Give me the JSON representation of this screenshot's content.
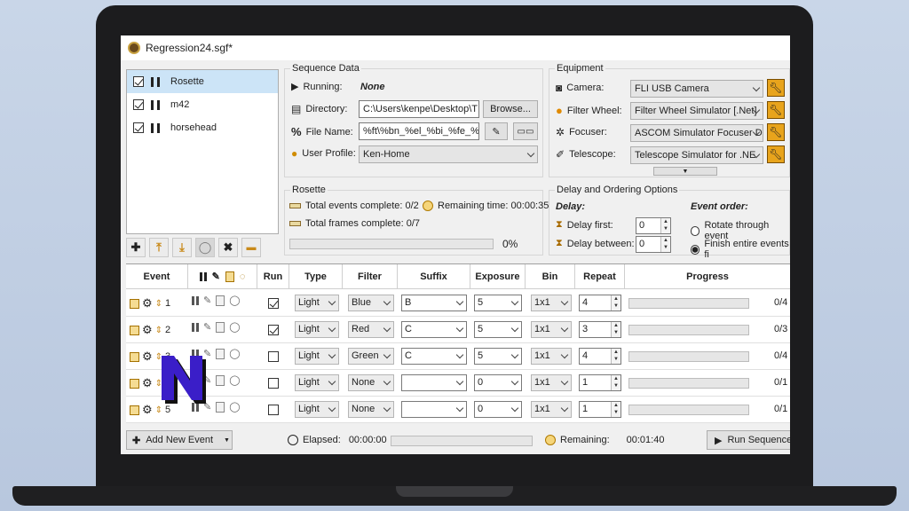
{
  "window": {
    "title": "Regression24.sgf*"
  },
  "targets": [
    {
      "name": "Rosette",
      "checked": true,
      "selected": true
    },
    {
      "name": "m42",
      "checked": true,
      "selected": false
    },
    {
      "name": "horsehead",
      "checked": true,
      "selected": false
    }
  ],
  "target_toolbar": [
    "add-icon",
    "move-up-icon",
    "move-down-icon",
    "circle-icon",
    "delete-icon",
    "filter-icon"
  ],
  "sequence_data": {
    "title": "Sequence Data",
    "running_label": "Running:",
    "running_value": "None",
    "directory_label": "Directory:",
    "directory_value": "C:\\Users\\kenpe\\Desktop\\T",
    "browse_label": "Browse...",
    "filename_label": "File Name:",
    "filename_value": "%ft\\%bn_%el_%bi_%fe_%fn",
    "profile_label": "User Profile:",
    "profile_value": "Ken-Home"
  },
  "equipment": {
    "title": "Equipment",
    "camera_label": "Camera:",
    "camera_value": "FLI USB Camera",
    "filterwheel_label": "Filter Wheel:",
    "filterwheel_value": "Filter Wheel Simulator [.Net]",
    "focuser_label": "Focuser:",
    "focuser_value": "ASCOM Simulator Focuser D",
    "telescope_label": "Telescope:",
    "telescope_value": "Telescope Simulator for .NE"
  },
  "target_status": {
    "title": "Rosette",
    "events_complete": "Total events complete: 0/2",
    "frames_complete": "Total frames complete: 0/7",
    "remaining": "Remaining time: 00:00:35",
    "percent": "0%",
    "progress": 0
  },
  "delay": {
    "title": "Delay and Ordering Options",
    "delay_heading": "Delay:",
    "delay_first_label": "Delay first:",
    "delay_first_value": "0",
    "delay_between_label": "Delay between:",
    "delay_between_value": "0",
    "order_heading": "Event order:",
    "order_option1": "Rotate through event",
    "order_option2": "Finish entire events fi",
    "selected_order": 2
  },
  "table": {
    "headers": {
      "event": "Event",
      "run": "Run",
      "type": "Type",
      "filter": "Filter",
      "suffix": "Suffix",
      "exposure": "Exposure",
      "bin": "Bin",
      "repeat": "Repeat",
      "progress": "Progress"
    },
    "rows": [
      {
        "num": "1",
        "run": true,
        "type": "Light",
        "filter": "Blue",
        "suffix": "B",
        "exposure": "5",
        "bin": "1x1",
        "repeat": "4",
        "progress": "0/4"
      },
      {
        "num": "2",
        "run": true,
        "type": "Light",
        "filter": "Red",
        "suffix": "C",
        "exposure": "5",
        "bin": "1x1",
        "repeat": "3",
        "progress": "0/3"
      },
      {
        "num": "3",
        "run": false,
        "type": "Light",
        "filter": "Green",
        "suffix": "C",
        "exposure": "5",
        "bin": "1x1",
        "repeat": "4",
        "progress": "0/4"
      },
      {
        "num": "4",
        "run": false,
        "type": "Light",
        "filter": "None",
        "suffix": "",
        "exposure": "0",
        "bin": "1x1",
        "repeat": "1",
        "progress": "0/1"
      },
      {
        "num": "5",
        "run": false,
        "type": "Light",
        "filter": "None",
        "suffix": "",
        "exposure": "0",
        "bin": "1x1",
        "repeat": "1",
        "progress": "0/1"
      }
    ]
  },
  "bottom": {
    "add_event_label": "Add New Event",
    "elapsed_label": "Elapsed:",
    "elapsed_value": "00:00:00",
    "remaining_label": "Remaining:",
    "remaining_value": "00:01:40",
    "run_label": "Run Sequence"
  },
  "colors": {
    "accent": "#e8a41c",
    "selection": "#cce4f7",
    "logo": "#3a1ec8"
  }
}
